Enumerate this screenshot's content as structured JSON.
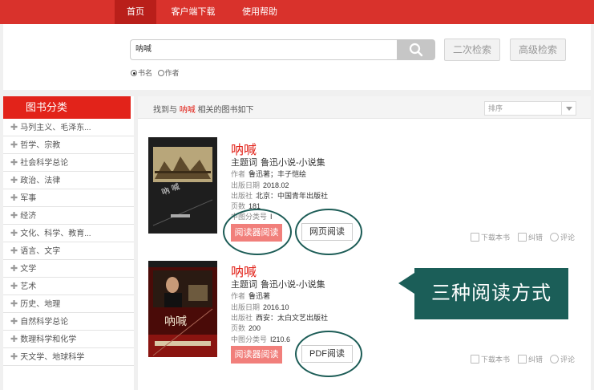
{
  "nav": {
    "home": "首页",
    "client_download": "客户端下载",
    "help": "使用帮助"
  },
  "search": {
    "value": "呐喊",
    "second_search": "二次检索",
    "advanced_search": "高级检索",
    "radio_title": "书名",
    "radio_author": "作者"
  },
  "sidebar": {
    "title": "图书分类",
    "items": [
      "马列主义、毛泽东...",
      "哲学、宗教",
      "社会科学总论",
      "政治、法律",
      "军事",
      "经济",
      "文化、科学、教育...",
      "语言、文字",
      "文学",
      "艺术",
      "历史、地理",
      "自然科学总论",
      "数理科学和化学",
      "天文学、地球科学"
    ]
  },
  "results": {
    "prefix": "找到与",
    "keyword": "呐喊",
    "suffix": "相关的图书如下",
    "sort_label": "排序"
  },
  "books": [
    {
      "title": "呐喊",
      "subject_label": "主题词",
      "subject": "鲁迅小说-小说集",
      "author_label": "作者",
      "author": "鲁迅著；丰子恺绘",
      "date_label": "出版日期",
      "date": "2018.02",
      "publisher_label": "出版社",
      "publisher": "北京：中国青年出版社",
      "pages_label": "页数",
      "pages": "181",
      "class_label": "中图分类号",
      "class": "I",
      "reader_btn": "阅读器阅读",
      "read_btn": "网页阅读",
      "download": "下载本书",
      "report": "纠错",
      "comment": "评论"
    },
    {
      "title": "呐喊",
      "subject_label": "主题词",
      "subject": "鲁迅小说-小说集",
      "author_label": "作者",
      "author": "鲁迅著",
      "date_label": "出版日期",
      "date": "2016.10",
      "publisher_label": "出版社",
      "publisher": "西安：太白文艺出版社",
      "pages_label": "页数",
      "pages": "200",
      "class_label": "中图分类号",
      "class": "I210.6",
      "reader_btn": "阅读器阅读",
      "read_btn": "PDF阅读",
      "download": "下载本书",
      "report": "纠错",
      "comment": "评论"
    }
  ],
  "annotation": {
    "text": "三种阅读方式"
  },
  "colors": {
    "brand_red": "#d9322c",
    "callout_teal": "#1b5e58"
  }
}
